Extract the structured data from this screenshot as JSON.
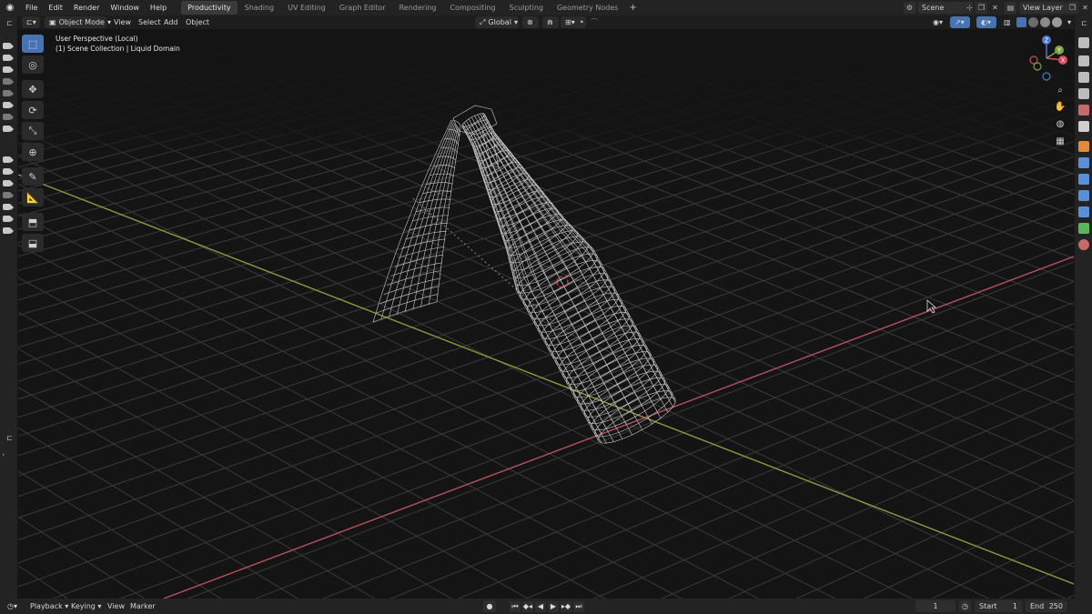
{
  "menubar": {
    "items": [
      "File",
      "Edit",
      "Render",
      "Window",
      "Help"
    ],
    "workspaces": [
      "Productivity",
      "Shading",
      "UV Editing",
      "Graph Editor",
      "Rendering",
      "Compositing",
      "Sculpting",
      "Geometry Nodes"
    ],
    "active_workspace": "Productivity",
    "add_workspace": "+",
    "scene": "Scene",
    "view_layer": "View Layer"
  },
  "viewport_header": {
    "mode": "Object Mode",
    "menus": [
      "View",
      "Select",
      "Add",
      "Object"
    ],
    "transform_orientation": "Global"
  },
  "viewport": {
    "perspective_label": "User Perspective (Local)",
    "collection_label": "(1) Scene Collection | Liquid Domain",
    "x_axis_color": "#b8505e",
    "y_axis_color": "#8f9a3c",
    "grid_color": "#3a3a3a",
    "mesh_color": "#c8c8c8"
  },
  "toolbar": {
    "tools": [
      "select-box-icon",
      "cursor-icon",
      "move-icon",
      "rotate-icon",
      "scale-icon",
      "transform-icon",
      "annotate-icon",
      "measure-icon",
      "add-cube-icon",
      "add-object-icon"
    ],
    "active_tool": "select-box-icon"
  },
  "gizmo": {
    "x_label": "X",
    "y_label": "Y",
    "z_label": "Z"
  },
  "timeline": {
    "menus": [
      "Playback",
      "Keying",
      "View",
      "Marker"
    ],
    "current_frame": "1",
    "start_label": "Start",
    "start_value": "1",
    "end_label": "End",
    "end_value": "250"
  }
}
